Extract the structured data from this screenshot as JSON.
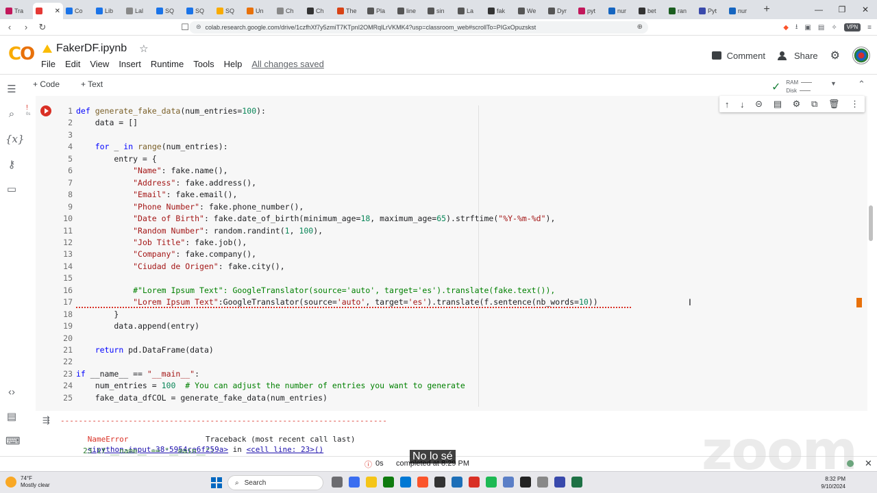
{
  "browser": {
    "tabs": [
      {
        "label": "Tra",
        "color": "#c2185b"
      },
      {
        "label": "",
        "color": "#e53935",
        "active": true
      },
      {
        "label": "Co",
        "color": "#1a73e8"
      },
      {
        "label": "Lib",
        "color": "#1a73e8"
      },
      {
        "label": "Lal",
        "color": "#888888"
      },
      {
        "label": "SQ",
        "color": "#1a73e8"
      },
      {
        "label": "SQ",
        "color": "#1a73e8"
      },
      {
        "label": "SQ",
        "color": "#f9ab00"
      },
      {
        "label": "Un",
        "color": "#e8710a"
      },
      {
        "label": "Ch",
        "color": "#888888"
      },
      {
        "label": "Ch",
        "color": "#333333"
      },
      {
        "label": "The",
        "color": "#d84315"
      },
      {
        "label": "Pla",
        "color": "#555555"
      },
      {
        "label": "line",
        "color": "#555555"
      },
      {
        "label": "sin",
        "color": "#555555"
      },
      {
        "label": "La",
        "color": "#555555"
      },
      {
        "label": "fak",
        "color": "#333333"
      },
      {
        "label": "We",
        "color": "#555555"
      },
      {
        "label": "Dyr",
        "color": "#555555"
      },
      {
        "label": "pyt",
        "color": "#c2185b"
      },
      {
        "label": "nur",
        "color": "#1565c0"
      },
      {
        "label": "bet",
        "color": "#333333"
      },
      {
        "label": "ran",
        "color": "#1b5e20"
      },
      {
        "label": "Pyt",
        "color": "#3949ab"
      },
      {
        "label": "nur",
        "color": "#1565c0"
      }
    ],
    "new_tab": "+",
    "url": "colab.research.google.com/drive/1czfhXf7y5zmiT7KTpnI2OMRqlLrVKMK4?usp=classroom_web#scrollTo=PIGxOpuzskst",
    "vpn": "VPN"
  },
  "colab": {
    "logo": "CO",
    "title": "FakerDF.ipynb",
    "menu": [
      "File",
      "Edit",
      "View",
      "Insert",
      "Runtime",
      "Tools",
      "Help"
    ],
    "saved": "All changes saved",
    "comment": "Comment",
    "share": "Share",
    "add_code": "+ Code",
    "add_text": "+ Text",
    "ram": "RAM",
    "disk": "Disk"
  },
  "cell": {
    "exec_time": "0s",
    "lines": [
      [
        {
          "t": "def ",
          "c": "kw"
        },
        {
          "t": "generate_fake_data",
          "c": "fn"
        },
        {
          "t": "(num_entries="
        },
        {
          "t": "100",
          "c": "num"
        },
        {
          "t": "):"
        }
      ],
      [
        {
          "t": "    data = []"
        }
      ],
      [
        {
          "t": ""
        }
      ],
      [
        {
          "t": "    "
        },
        {
          "t": "for",
          "c": "kw"
        },
        {
          "t": " _ "
        },
        {
          "t": "in",
          "c": "kw"
        },
        {
          "t": " "
        },
        {
          "t": "range",
          "c": "fn"
        },
        {
          "t": "(num_entries):"
        }
      ],
      [
        {
          "t": "        entry = {"
        }
      ],
      [
        {
          "t": "            "
        },
        {
          "t": "\"Name\"",
          "c": "str"
        },
        {
          "t": ": fake.name(),"
        }
      ],
      [
        {
          "t": "            "
        },
        {
          "t": "\"Address\"",
          "c": "str"
        },
        {
          "t": ": fake.address(),"
        }
      ],
      [
        {
          "t": "            "
        },
        {
          "t": "\"Email\"",
          "c": "str"
        },
        {
          "t": ": fake.email(),"
        }
      ],
      [
        {
          "t": "            "
        },
        {
          "t": "\"Phone Number\"",
          "c": "str"
        },
        {
          "t": ": fake.phone_number(),"
        }
      ],
      [
        {
          "t": "            "
        },
        {
          "t": "\"Date of Birth\"",
          "c": "str"
        },
        {
          "t": ": fake.date_of_birth(minimum_age="
        },
        {
          "t": "18",
          "c": "num"
        },
        {
          "t": ", maximum_age="
        },
        {
          "t": "65",
          "c": "num"
        },
        {
          "t": ").strftime("
        },
        {
          "t": "\"%Y-%m-%d\"",
          "c": "str"
        },
        {
          "t": "),"
        }
      ],
      [
        {
          "t": "            "
        },
        {
          "t": "\"Random Number\"",
          "c": "str"
        },
        {
          "t": ": random.randint("
        },
        {
          "t": "1",
          "c": "num"
        },
        {
          "t": ", "
        },
        {
          "t": "100",
          "c": "num"
        },
        {
          "t": "),"
        }
      ],
      [
        {
          "t": "            "
        },
        {
          "t": "\"Job Title\"",
          "c": "str"
        },
        {
          "t": ": fake.job(),"
        }
      ],
      [
        {
          "t": "            "
        },
        {
          "t": "\"Company\"",
          "c": "str"
        },
        {
          "t": ": fake.company(),"
        }
      ],
      [
        {
          "t": "            "
        },
        {
          "t": "\"Ciudad de Origen\"",
          "c": "str"
        },
        {
          "t": ": fake.city(),"
        }
      ],
      [
        {
          "t": ""
        }
      ],
      [
        {
          "t": "            "
        },
        {
          "t": "#\"Lorem Ipsum Text\": GoogleTranslator(source='auto', target='es').translate(fake.text()),",
          "c": "cmt"
        }
      ],
      [
        {
          "t": "            "
        },
        {
          "t": "\"Lorem Ipsum Text\"",
          "c": "str"
        },
        {
          "t": ":GoogleTranslator(source="
        },
        {
          "t": "'auto'",
          "c": "str"
        },
        {
          "t": ", target="
        },
        {
          "t": "'es'",
          "c": "str"
        },
        {
          "t": ").translate(f.sentence(nb_words="
        },
        {
          "t": "10",
          "c": "num"
        },
        {
          "t": "))"
        }
      ],
      [
        {
          "t": "        }"
        }
      ],
      [
        {
          "t": "        data.append(entry)"
        }
      ],
      [
        {
          "t": ""
        }
      ],
      [
        {
          "t": "    "
        },
        {
          "t": "return",
          "c": "kw"
        },
        {
          "t": " pd.DataFrame(data)"
        }
      ],
      [
        {
          "t": ""
        }
      ],
      [
        {
          "t": "if",
          "c": "kw"
        },
        {
          "t": " __name__ == "
        },
        {
          "t": "\"__main__\"",
          "c": "str"
        },
        {
          "t": ":"
        }
      ],
      [
        {
          "t": "    num_entries = "
        },
        {
          "t": "100",
          "c": "num"
        },
        {
          "t": "  "
        },
        {
          "t": "# You can adjust the number of entries you want to generate",
          "c": "cmt"
        }
      ],
      [
        {
          "t": "    fake_data_dfCOL = generate_fake_data(num_entries)"
        }
      ]
    ]
  },
  "output": {
    "dashes": "------------------------------------------------------------------------",
    "error_name": "NameError",
    "traceback": "Traceback (most recent call last)",
    "input_ref": "<ipython-input-38-5954ce6f259a>",
    "in_text": " in ",
    "cell_ref": "<cell line: 23>()",
    "line23": "     23 if __name__ == \"__main__\":"
  },
  "status": {
    "time": "0s",
    "completed": "completed at 8:29 PM"
  },
  "zoom": {
    "subtitle": "No lo sé",
    "watermark": "zoom"
  },
  "taskbar": {
    "temp": "74°F",
    "weather": "Mostly clear",
    "search": "Search",
    "time": "8:32 PM",
    "date": "9/10/2024",
    "apps": [
      "#6c6c70",
      "#3a6df0",
      "#f5c518",
      "#0f7b0f",
      "#0078d4",
      "#fb542b",
      "#333333",
      "#1d6fb8",
      "#d93025",
      "#1db954",
      "#5b7fc7",
      "#222222",
      "#888888",
      "#3949ab",
      "#1e7145"
    ]
  }
}
